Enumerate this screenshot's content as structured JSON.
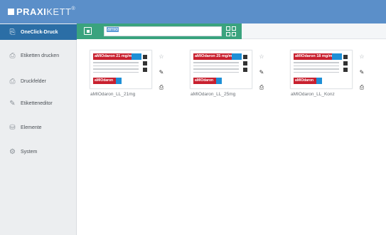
{
  "app": {
    "logo_bold": "PRAXI",
    "logo_light": "KETT",
    "logo_mark": "®"
  },
  "sidebar": {
    "items": [
      {
        "label": "OneClick-Druck",
        "icon": "oneclick-icon",
        "active": true
      },
      {
        "label": "Etiketten drucken",
        "icon": "printer-label-icon"
      },
      {
        "label": "Druckfelder",
        "icon": "printer-icon"
      },
      {
        "label": "Etiketteneditor",
        "icon": "editor-icon"
      },
      {
        "label": "Elemente",
        "icon": "database-icon"
      },
      {
        "label": "System",
        "icon": "gear-icon"
      }
    ]
  },
  "toolbar": {
    "search_value": "amio",
    "accent_color": "#3aa37e"
  },
  "cards": [
    {
      "name": "aMIOdaron_LL_21mg",
      "label_title": "aMIOdaron 21 mg/ml",
      "label_bottom": "aMIOdaron"
    },
    {
      "name": "aMIOdaron_LL_25mg",
      "label_title": "aMIOdaron 25 mg/ml",
      "label_bottom": "aMIOdaron"
    },
    {
      "name": "aMIOdaron_LL_Konz",
      "label_title": "aMIOdaron 18 mg/ml",
      "label_bottom": "aMIOdaron"
    }
  ],
  "colors": {
    "header": "#5b8fc9",
    "sidebar_active": "#2b6ea6",
    "label_red": "#c8202f",
    "label_blue": "#1e8fd6"
  }
}
